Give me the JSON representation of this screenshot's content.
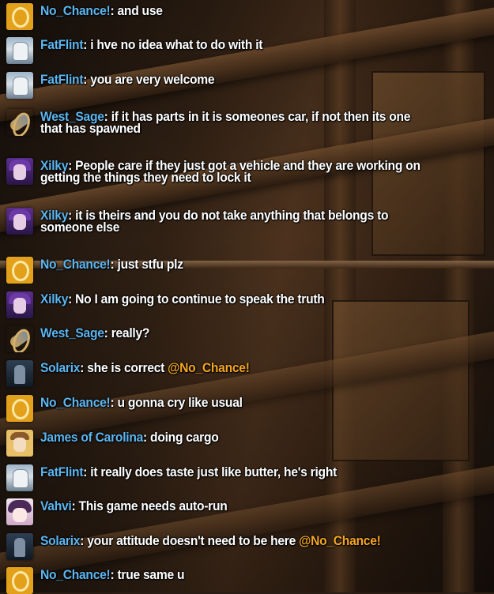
{
  "chat": {
    "messages": [
      {
        "user": "No_Chance!",
        "avatar": "orange-ring-icon",
        "text": ": and use"
      },
      {
        "user": "FatFlint",
        "avatar": "knight-helmet-icon",
        "text": ": i hve no idea what to do with it"
      },
      {
        "user": "FatFlint",
        "avatar": "knight-helmet-icon",
        "text": ": you are very welcome"
      },
      {
        "user": "West_Sage",
        "avatar": "swirl-emblem-icon",
        "text": ": if it has parts in it is someones car, if not then its one that has spawned"
      },
      {
        "user": "Xilky",
        "avatar": "purple-character-icon",
        "text": ": People care if they just got a vehicle and they are working on getting the things they need to lock it"
      },
      {
        "user": "Xilky",
        "avatar": "purple-character-icon",
        "text": ": it is theirs and you do not take anything that belongs to someone else"
      },
      {
        "user": "No_Chance!",
        "avatar": "orange-ring-icon",
        "text": ": just stfu plz"
      },
      {
        "user": "Xilky",
        "avatar": "purple-character-icon",
        "text": ": No I am going to continue to speak the truth"
      },
      {
        "user": "West_Sage",
        "avatar": "swirl-emblem-icon",
        "text": ": really?"
      },
      {
        "user": "Solarix",
        "avatar": "dark-soldier-icon",
        "text": ": she is correct ",
        "mention": "@No_Chance!"
      },
      {
        "user": "No_Chance!",
        "avatar": "orange-ring-icon",
        "text": ": u gonna cry like usual"
      },
      {
        "user": "James of Carolina",
        "avatar": "portrait-icon",
        "text": ": doing cargo"
      },
      {
        "user": "FatFlint",
        "avatar": "knight-helmet-icon",
        "text": ": it really does taste just like butter, he's right"
      },
      {
        "user": "Vahvi",
        "avatar": "anime-girl-icon",
        "text": ": This game needs auto-run"
      },
      {
        "user": "Solarix",
        "avatar": "dark-soldier-icon",
        "text": ": your attitude doesn't need to be here ",
        "mention": "@No_Chance!"
      },
      {
        "user": "No_Chance!",
        "avatar": "orange-ring-icon",
        "text": ": true same u"
      }
    ]
  },
  "colors": {
    "username": "#5db6f0",
    "mention": "#f5a623",
    "message": "#ffffff"
  }
}
